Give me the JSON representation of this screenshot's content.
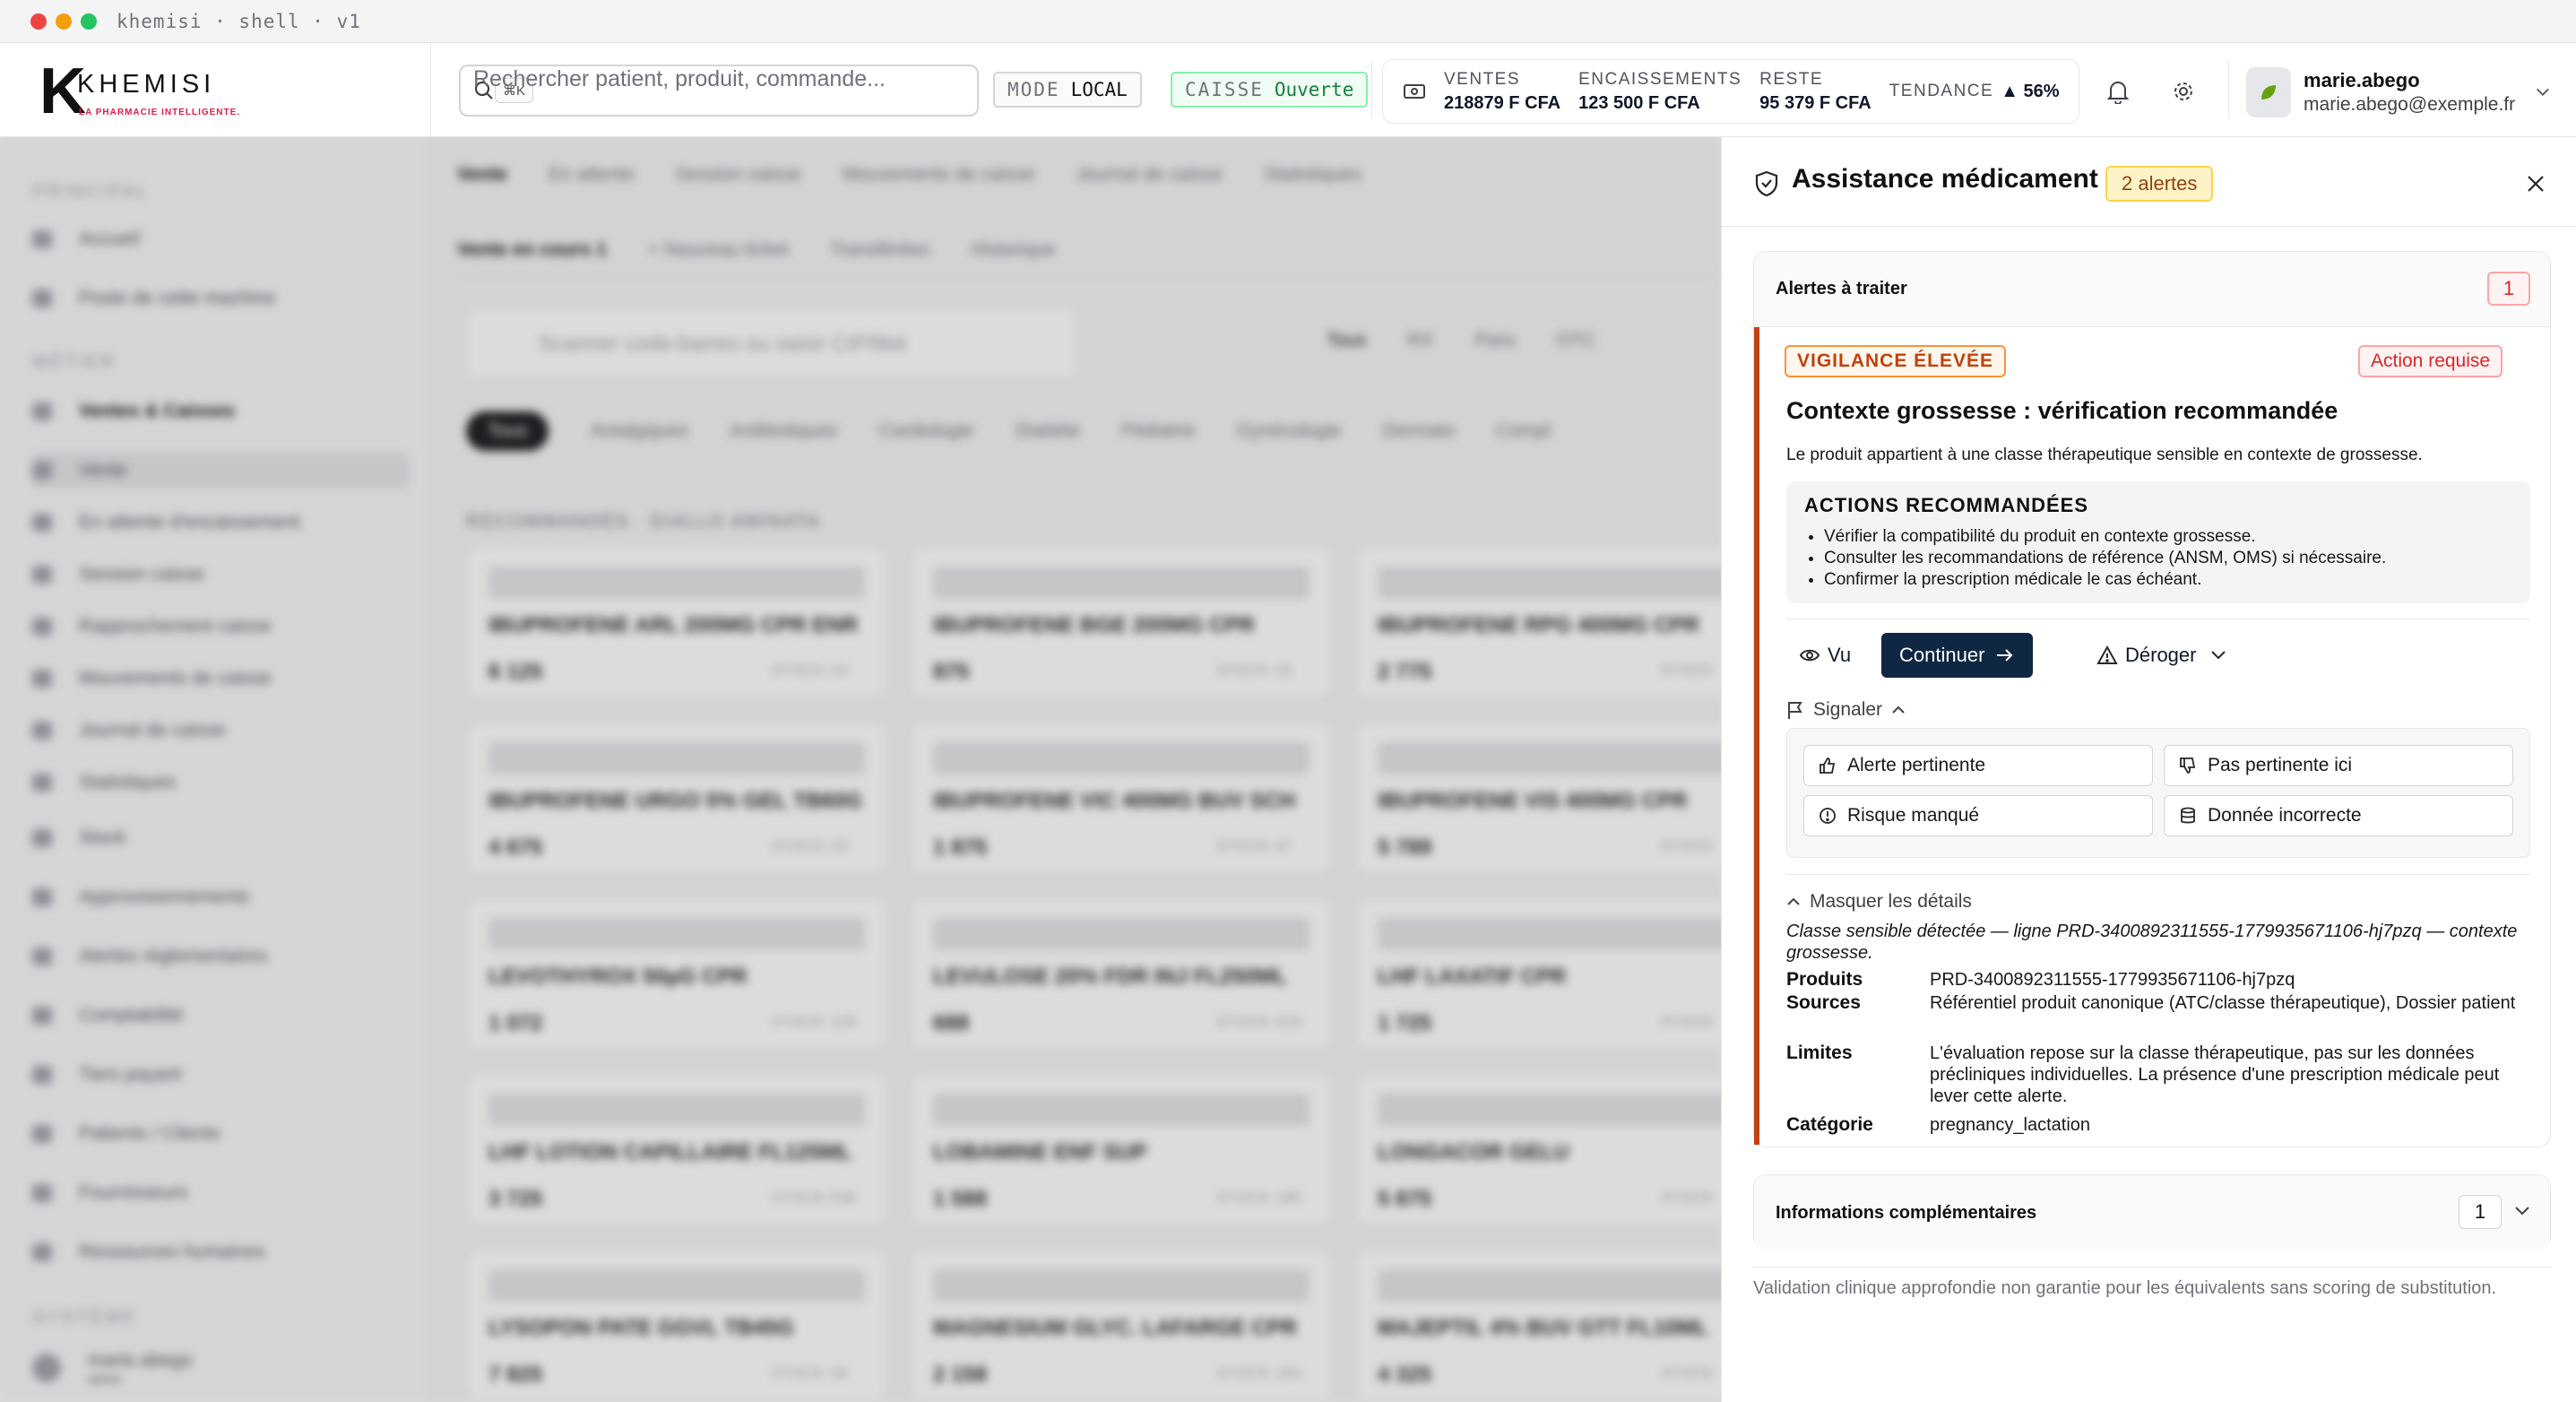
{
  "window": {
    "title": "khemisi · shell · v1",
    "dots": [
      "#ef4444",
      "#f59e0b",
      "#22c55e"
    ]
  },
  "brand": {
    "letter": "K",
    "name": "KHEMISI",
    "tagline": "LA PHARMACIE INTELLIGENTE."
  },
  "search": {
    "placeholder": "Rechercher patient, produit, commande...",
    "shortcut": "⌘K"
  },
  "mode": {
    "label": "MODE",
    "value": "LOCAL"
  },
  "caisse": {
    "label": "CAISSE",
    "value": "Ouverte"
  },
  "stats": {
    "ventes": {
      "label": "VENTES",
      "value": "218879 F CFA"
    },
    "encaissements": {
      "label": "ENCAISSEMENTS",
      "value": "123 500 F CFA"
    },
    "reste": {
      "label": "RESTE",
      "value": "95 379 F CFA"
    },
    "tendance": {
      "label": "TENDANCE",
      "value": "▲ 56%"
    }
  },
  "user": {
    "name": "marie.abego",
    "email": "marie.abego@exemple.fr"
  },
  "background": {
    "sidebar": {
      "section1": "PRINCIPAL",
      "items1": [
        "Accueil",
        "Poste de cette machine"
      ],
      "section2": "MÉTIER",
      "items2": [
        "Ventes & Caisses",
        "Vente",
        "En attente d'encaissement",
        "Session caisse",
        "Rapprochement caisse",
        "Mouvements de caisse",
        "Journal de caisse",
        "Statistiques",
        "Stock",
        "Approvisionnements",
        "Alertes réglementaires",
        "Comptabilité",
        "Tiers payant",
        "Patients / Clients",
        "Fournisseurs",
        "Ressources humaines"
      ],
      "section3": "SYSTÈME",
      "footer_user": "marie.abego",
      "footer_role": "admin"
    },
    "top_tabs": [
      "Vente",
      "En attente",
      "Session caisse",
      "Mouvements de caisse",
      "Journal de caisse",
      "Statistiques"
    ],
    "sub_tabs": [
      "Vente en cours 1",
      "+ Nouveau ticket",
      "Transférées",
      "Historique"
    ],
    "scan_placeholder": "Scanner code-barres ou saisir CIP/libé",
    "filters": [
      "Tous",
      "RX",
      "Para",
      "OTC"
    ],
    "categories": [
      "Tous",
      "Antalgiques",
      "Antibiotiques",
      "Cardiologie",
      "Diabète",
      "Pédiatrie",
      "Gynécologie",
      "Dermato",
      "Compl"
    ],
    "section_label": "RECOMMANDÉS · DIALLO AMINATA",
    "products": [
      {
        "name": "IBUPROFENE ARL 200MG CPR ENR",
        "price": "6 125",
        "stock": "STOCK 19"
      },
      {
        "name": "IBUPROFENE BGE 200MG CPR",
        "price": "875",
        "stock": "STOCK 16"
      },
      {
        "name": "IBUPROFENE RPG 400MG CPR",
        "price": "2 775",
        "stock": "STOCK"
      },
      {
        "name": "IBUPROFENE URGO 5% GEL TB60G",
        "price": "4 675",
        "stock": "STOCK 19"
      },
      {
        "name": "IBUPROFENE VIC 400MG BUV SCH",
        "price": "1 875",
        "stock": "STOCK 47"
      },
      {
        "name": "IBUPROFENE VIS 400MG CPR",
        "price": "5 789",
        "stock": "STOCK"
      },
      {
        "name": "LEVOTHYROX 50µG CPR",
        "price": "1 072",
        "stock": "STOCK 128"
      },
      {
        "name": "LEVULOSE 20% FDR INJ FL250ML",
        "price": "688",
        "stock": "STOCK 318"
      },
      {
        "name": "LHF LAXATIF CPR",
        "price": "1 725",
        "stock": "STOCK"
      },
      {
        "name": "LHF LOTION CAPILLAIRE FL125ML",
        "price": "3 725",
        "stock": "STOCK 536"
      },
      {
        "name": "LOBAMINE ENF SUP",
        "price": "1 588",
        "stock": "STOCK 186"
      },
      {
        "name": "LONGACOR GELU",
        "price": "5 875",
        "stock": "STOCK"
      },
      {
        "name": "LYSOPON PATE GGVL TB45G",
        "price": "7 825",
        "stock": "STOCK 38"
      },
      {
        "name": "MAGNESIUM GLYC. LAFARGE CPR",
        "price": "2 158",
        "stock": "STOCK 184"
      },
      {
        "name": "MAJEPTIL 4% BUV GTT FL10ML",
        "price": "4 325",
        "stock": "STOCK"
      }
    ]
  },
  "panel": {
    "title": "Assistance médicament",
    "badge": "2 alertes",
    "alerts_section": {
      "title": "Alertes à traiter",
      "count": "1"
    },
    "alert": {
      "level": "VIGILANCE ÉLEVÉE",
      "action": "Action requise",
      "title": "Contexte grossesse : vérification recommandée",
      "description": "Le produit appartient à une classe thérapeutique sensible en contexte de grossesse.",
      "reco_title": "ACTIONS RECOMMANDÉES",
      "reco_items": [
        "Vérifier la compatibilité du produit en contexte grossesse.",
        "Consulter les recommandations de référence (ANSM, OMS) si nécessaire.",
        "Confirmer la prescription médicale le cas échéant."
      ],
      "buttons": {
        "seen": "Vu",
        "continue": "Continuer",
        "derogate": "Déroger"
      },
      "report": {
        "label": "Signaler",
        "options": [
          "Alerte pertinente",
          "Pas pertinente ici",
          "Risque manqué",
          "Donnée incorrecte"
        ]
      },
      "details_toggle": "Masquer les détails",
      "details_note": "Classe sensible détectée — ligne PRD-3400892311555-1779935671106-hj7pzq — contexte grossesse.",
      "details": {
        "produits_label": "Produits",
        "produits": "PRD-3400892311555-1779935671106-hj7pzq",
        "sources_label": "Sources",
        "sources": "Référentiel produit canonique (ATC/classe thérapeutique), Dossier patient",
        "limites_label": "Limites",
        "limites": "L'évaluation repose sur la classe thérapeutique, pas sur les données précliniques individuelles. La présence d'une prescription médicale peut lever cette alerte.",
        "categorie_label": "Catégorie",
        "categorie": "pregnancy_lactation"
      }
    },
    "info_section": {
      "title": "Informations complémentaires",
      "count": "1"
    },
    "footer": "Validation clinique approfondie non garantie pour les équivalents sans scoring de substitution."
  }
}
